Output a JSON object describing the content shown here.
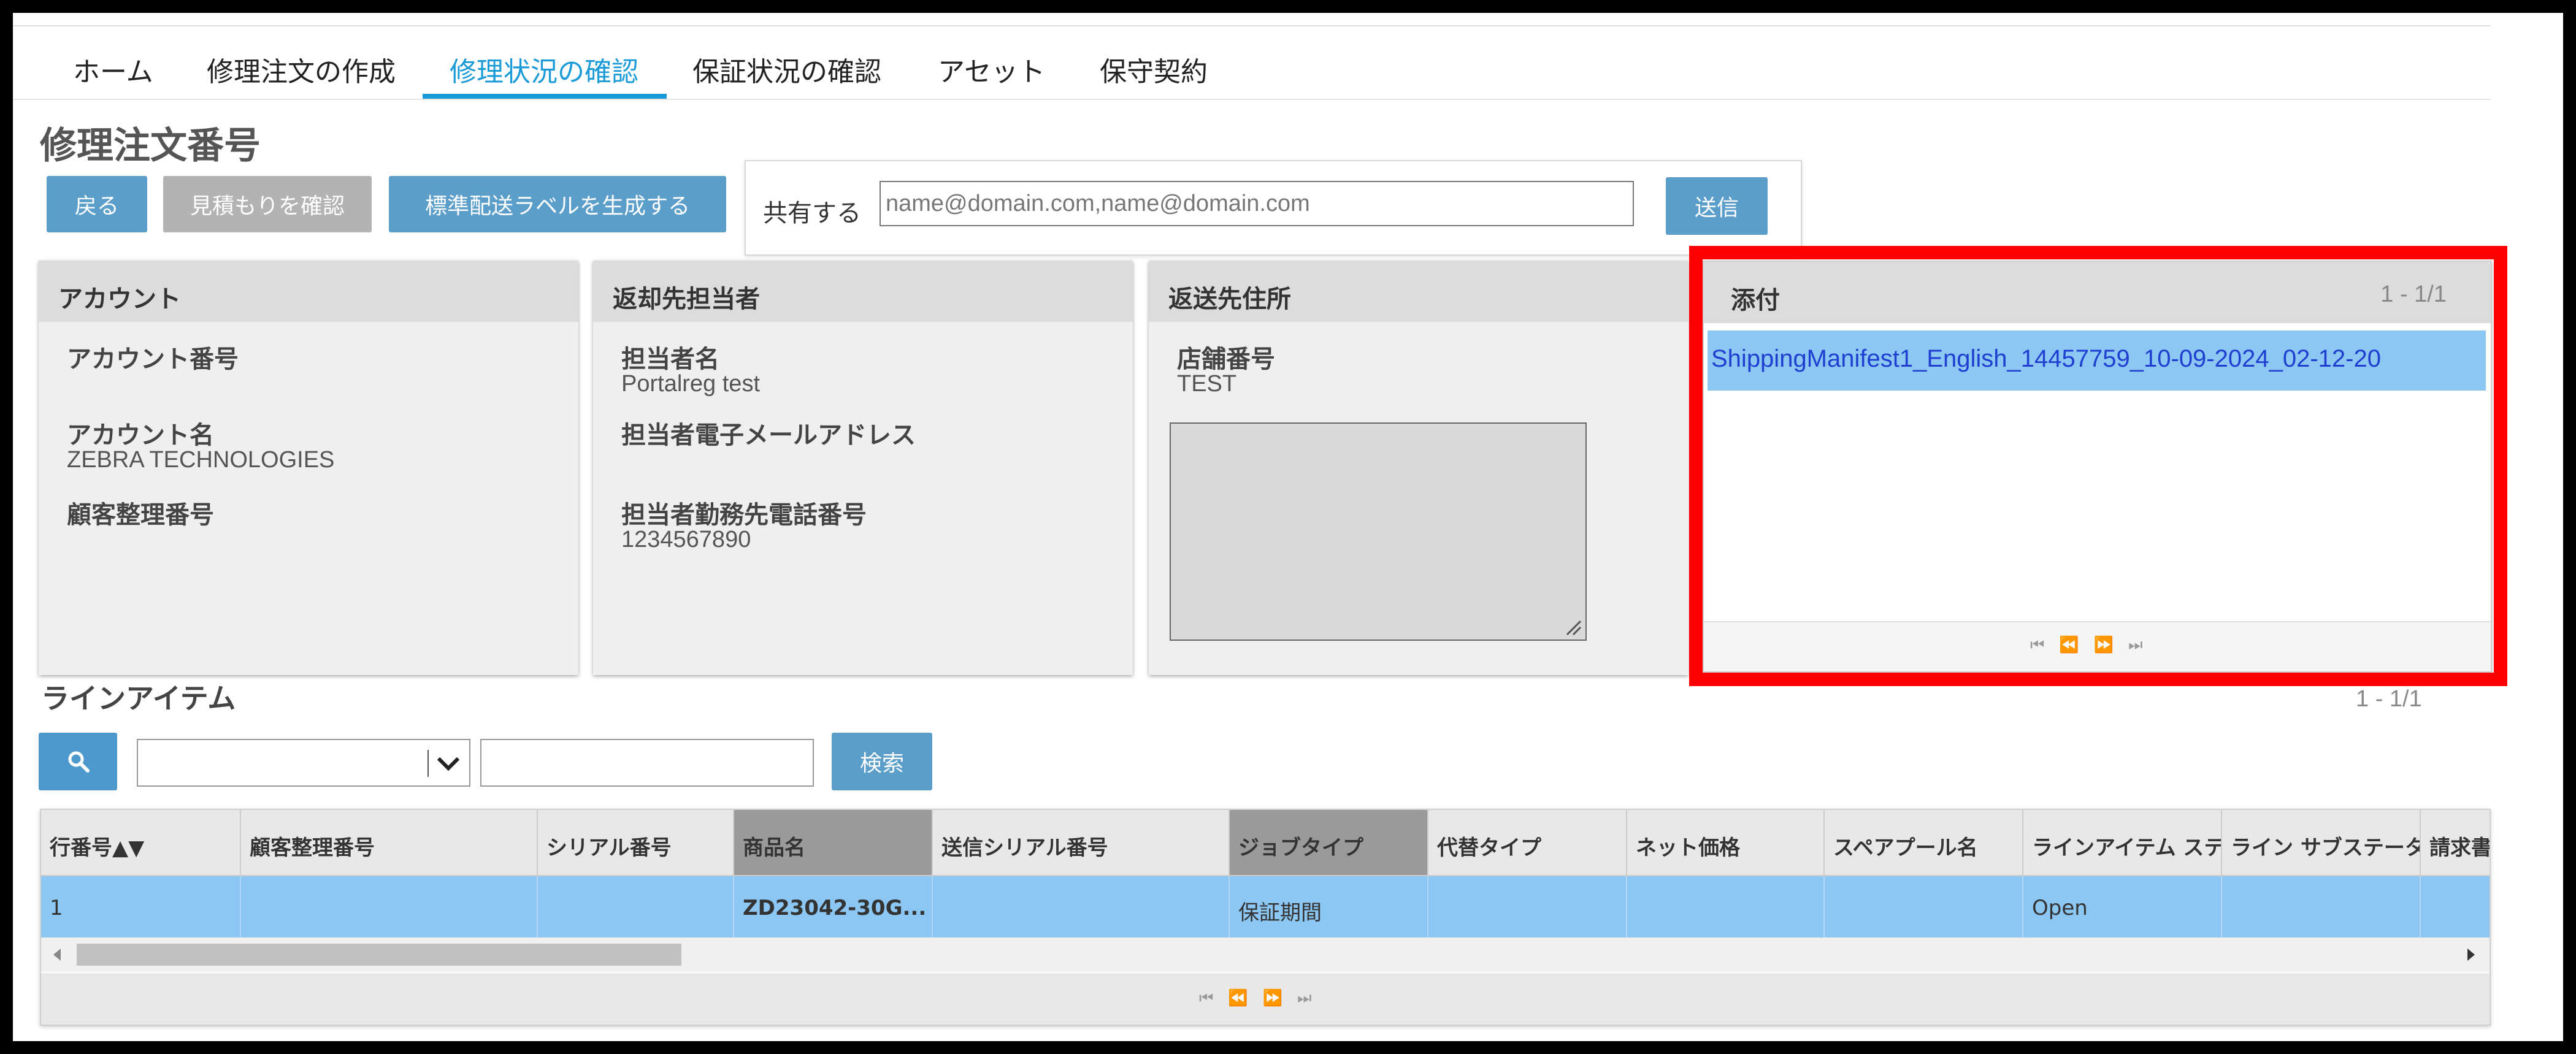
{
  "tabs": [
    {
      "label": "ホーム"
    },
    {
      "label": "修理注文の作成"
    },
    {
      "label": "修理状況の確認"
    },
    {
      "label": "保証状況の確認"
    },
    {
      "label": "アセット"
    },
    {
      "label": "保守契約"
    }
  ],
  "active_tab_index": 2,
  "page_title": "修理注文番号",
  "buttons": {
    "back": "戻る",
    "view_quote": "見積もりを確認",
    "generate_label": "標準配送ラベルを生成する"
  },
  "share": {
    "label": "共有する",
    "placeholder": "name@domain.com,name@domain.com",
    "send": "送信"
  },
  "account_card": {
    "title": "アカウント",
    "fields": [
      {
        "label": "アカウント番号",
        "value": ""
      },
      {
        "label": "アカウント名",
        "value": "ZEBRA TECHNOLOGIES"
      },
      {
        "label": "顧客整理番号",
        "value": ""
      }
    ]
  },
  "contact_card": {
    "title": "返却先担当者",
    "fields": [
      {
        "label": "担当者名",
        "value": "Portalreg test"
      },
      {
        "label": "担当者電子メールアドレス",
        "value": ""
      },
      {
        "label": "担当者勤務先電話番号",
        "value": "1234567890"
      }
    ]
  },
  "address_card": {
    "title": "返送先住所",
    "fields": [
      {
        "label": "店舗番号",
        "value": "TEST"
      }
    ]
  },
  "attachments": {
    "title": "添付",
    "count": "1 - 1/1",
    "items": [
      "ShippingManifest1_English_14457759_10-09-2024_02-12-20"
    ]
  },
  "line_items": {
    "title": "ラインアイテム",
    "count": "1 - 1/1",
    "search_button": "検索",
    "columns": [
      "行番号▲▼",
      "顧客整理番号",
      "シリアル番号",
      "商品名",
      "送信シリアル番号",
      "ジョブタイプ",
      "代替タイプ",
      "ネット価格",
      "スペアプール名",
      "ラインアイテム ステ",
      "ライン サブステータ",
      "請求書"
    ],
    "rows": [
      [
        "1",
        "",
        "",
        "ZD23042-30G...",
        "",
        "保証期間",
        "",
        "",
        "",
        "Open",
        "",
        ""
      ]
    ]
  },
  "colors": {
    "accent": "#1a9bd7",
    "button": "#5b9ec9",
    "selected_row": "#8cc6f2",
    "highlight": "#ff0000"
  }
}
